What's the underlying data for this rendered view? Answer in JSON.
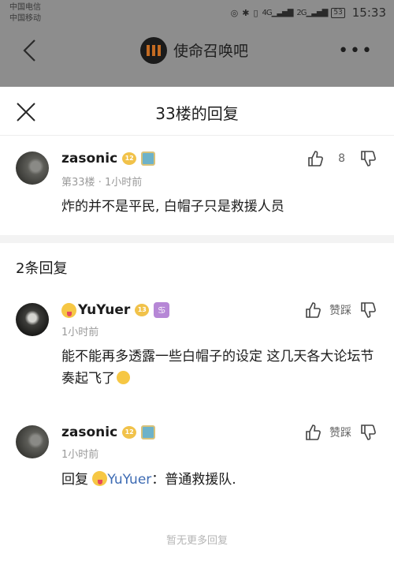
{
  "status_bar": {
    "carrier1": "中国电信",
    "carrier2": "中国移动",
    "signal_4g": "4G",
    "signal_2g": "2G",
    "battery": "53",
    "time": "15:33"
  },
  "header": {
    "forum_name": "使命召唤吧"
  },
  "sheet": {
    "title": "33楼的回复",
    "main_post": {
      "username": "zasonic",
      "level": "12",
      "floor": "第33楼",
      "time": "1小时前",
      "content": "炸的并不是平民, 白帽子只是救援人员",
      "likes": "8"
    },
    "reply_count": "2条回复",
    "replies": [
      {
        "username": "YuYuer",
        "level": "13",
        "badge": "♋",
        "time": "1小时前",
        "content": "能不能再多透露一些白帽子的设定 这几天各大论坛节奏起飞了",
        "action_label": "赞踩"
      },
      {
        "username": "zasonic",
        "level": "12",
        "time": "1小时前",
        "reply_prefix": "回复",
        "reply_to": "YuYuer",
        "content": "：普通救援队.",
        "action_label": "赞踩"
      }
    ],
    "footer": "暂无更多回复"
  },
  "icons": {
    "back": "back-arrow-icon",
    "more": "more-dots-icon",
    "close": "close-icon",
    "like": "thumb-up-icon",
    "dislike": "thumb-down-icon"
  }
}
